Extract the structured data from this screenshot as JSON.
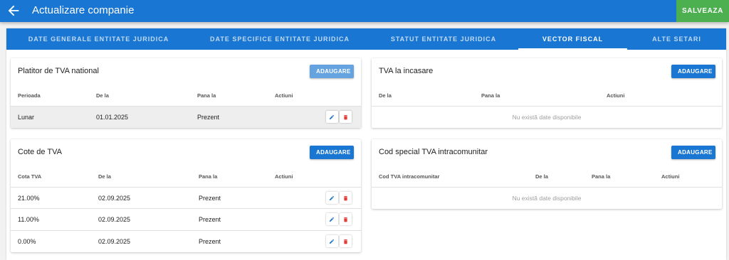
{
  "header": {
    "title": "Actualizare companie",
    "save_label": "SALVEAZA",
    "back_icon": "arrow-left-icon"
  },
  "tabs": [
    {
      "label": "DATE GENERALE ENTITATE JURIDICA",
      "active": false
    },
    {
      "label": "DATE SPECIFICE ENTITATE JURIDICA",
      "active": false
    },
    {
      "label": "STATUT ENTITATE JURIDICA",
      "active": false
    },
    {
      "label": "VECTOR FISCAL",
      "active": true
    },
    {
      "label": "ALTE SETARI",
      "active": false
    }
  ],
  "tva_national": {
    "title": "Platitor de TVA national",
    "add_label": "ADAUGARE",
    "columns": [
      "Perioada",
      "De la",
      "Pana la",
      "Actiuni"
    ],
    "rows": [
      {
        "perioada": "Lunar",
        "de_la": "01.01.2025",
        "pana_la": "Prezent"
      }
    ]
  },
  "tva_incasare": {
    "title": "TVA la incasare",
    "add_label": "ADAUGARE",
    "columns": [
      "De la",
      "Pana la",
      "Actiuni"
    ],
    "empty_text": "Nu există date disponibile"
  },
  "cote_tva": {
    "title": "Cote de TVA",
    "add_label": "ADAUGARE",
    "columns": [
      "Cota TVA",
      "De la",
      "Pana la",
      "Actiuni"
    ],
    "rows": [
      {
        "cota": "21.00%",
        "de_la": "02.09.2025",
        "pana_la": "Prezent"
      },
      {
        "cota": "11.00%",
        "de_la": "02.09.2025",
        "pana_la": "Prezent"
      },
      {
        "cota": "0.00%",
        "de_la": "02.09.2025",
        "pana_la": "Prezent"
      }
    ]
  },
  "cod_special": {
    "title": "Cod special TVA intracomunitar",
    "add_label": "ADAUGARE",
    "columns": [
      "Cod TVA intracomunitar",
      "De la",
      "Pana la",
      "Actiuni"
    ],
    "empty_text": "Nu există date disponibile"
  },
  "colors": {
    "primary": "#1976d2",
    "save_green": "#4caf50",
    "edit_blue": "#1976d2",
    "delete_red": "#e53935"
  },
  "icons": {
    "edit": "pencil-icon",
    "delete": "trash-icon"
  }
}
